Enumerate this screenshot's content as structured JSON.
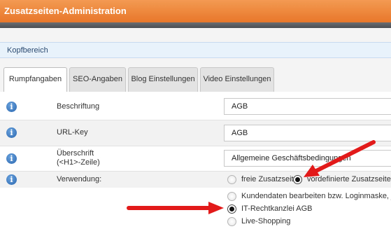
{
  "window": {
    "title": "Zusatzseiten-Administration"
  },
  "section": {
    "label": "Kopfbereich"
  },
  "tabs": [
    {
      "label": "Rumpfangaben",
      "active": true
    },
    {
      "label": "SEO-Angaben",
      "active": false
    },
    {
      "label": "Blog Einstellungen",
      "active": false
    },
    {
      "label": "Video Einstellungen",
      "active": false
    }
  ],
  "fields": {
    "beschriftung": {
      "label": "Beschriftung",
      "value": "AGB",
      "icon": "info-icon"
    },
    "url_key": {
      "label": "URL-Key",
      "value": "AGB",
      "icon": "info-icon"
    },
    "ueberschrift": {
      "label_line1": "Überschrift",
      "label_line2": "(<H1>-Zeile)",
      "value": "Allgemeine Geschäftsbedingungen",
      "icon": "info-icon"
    },
    "verwendung": {
      "label": "Verwendung:",
      "icon": "info-icon",
      "options": [
        {
          "label": "freie Zusatzseite",
          "checked": false
        },
        {
          "label": "vordefinierte Zusatzseite",
          "checked": true
        }
      ]
    }
  },
  "predefined_pages": [
    {
      "label": "Kundendaten bearbeiten bzw. Loginmaske, je nach",
      "checked": false
    },
    {
      "label": "IT-Rechtkanzlei AGB",
      "checked": true
    },
    {
      "label": "Live-Shopping",
      "checked": false
    }
  ],
  "colors": {
    "header": "#e8772a",
    "arrow": "#e21a1a",
    "info_icon": "#2a66b0",
    "section_bar": "#e8f2fb"
  }
}
